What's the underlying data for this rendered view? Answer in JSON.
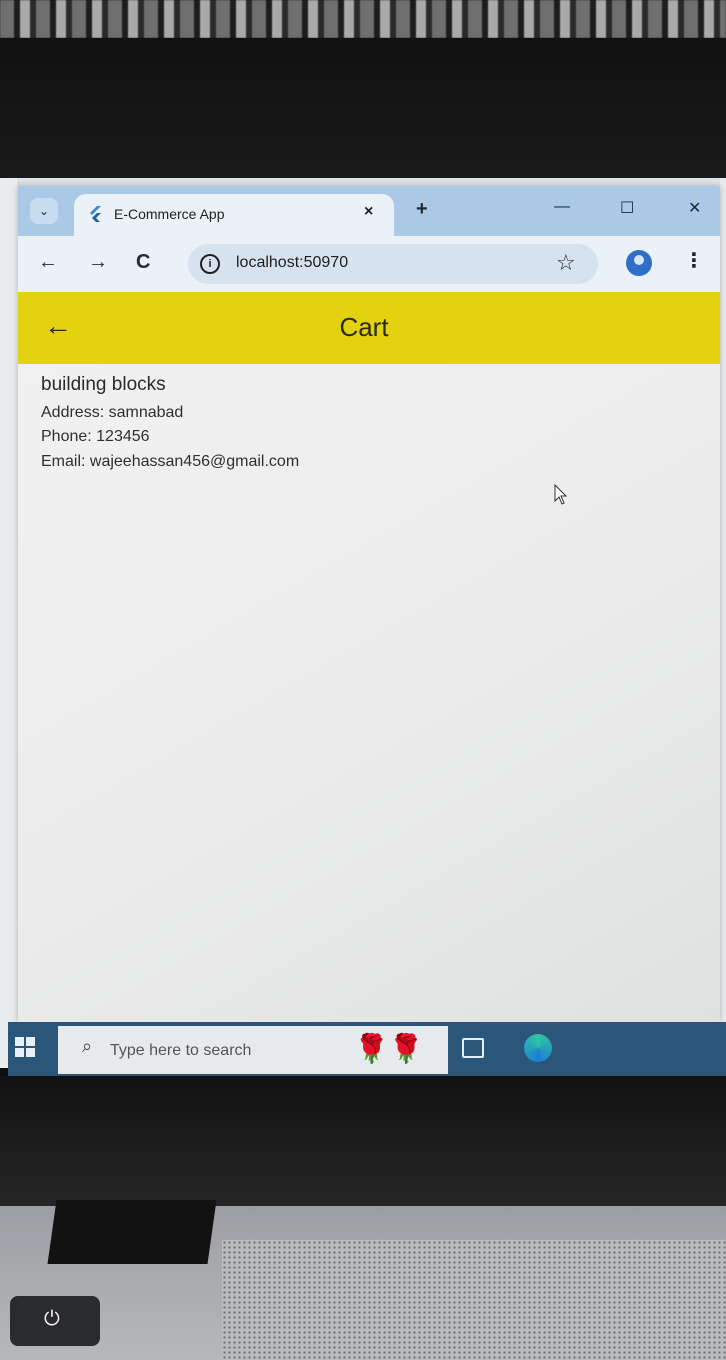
{
  "browser": {
    "tab_title": "E-Commerce App",
    "tab_close": "×",
    "new_tab": "+",
    "window_controls": {
      "minimize": "—",
      "maximize": "☐",
      "close": "✕"
    },
    "url": "localhost:50970"
  },
  "app": {
    "title": "Cart",
    "accent_color": "#e3d20f",
    "shop": {
      "name": "building blocks",
      "address": "Address: samnabad",
      "phone": "Phone: 123456",
      "email": "Email: wajeehassan456@gmail.com"
    }
  },
  "taskbar": {
    "search_placeholder": "Type here to search",
    "background_color": "#2a5779"
  },
  "icons": [
    "tab-search-icon",
    "flutter-icon",
    "back-icon",
    "forward-icon",
    "reload-icon",
    "info-icon",
    "star-icon",
    "profile-icon",
    "menu-icon",
    "back-arrow-icon",
    "windows-start-icon",
    "search-icon",
    "task-view-icon",
    "edge-icon",
    "power-icon"
  ]
}
